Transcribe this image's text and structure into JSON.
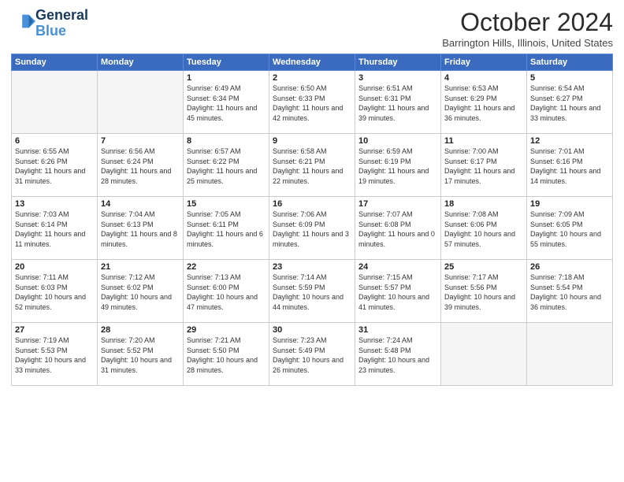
{
  "header": {
    "logo_line1": "General",
    "logo_line2": "Blue",
    "month_title": "October 2024",
    "subtitle": "Barrington Hills, Illinois, United States"
  },
  "weekdays": [
    "Sunday",
    "Monday",
    "Tuesday",
    "Wednesday",
    "Thursday",
    "Friday",
    "Saturday"
  ],
  "weeks": [
    [
      {
        "day": "",
        "info": ""
      },
      {
        "day": "",
        "info": ""
      },
      {
        "day": "1",
        "info": "Sunrise: 6:49 AM\nSunset: 6:34 PM\nDaylight: 11 hours and 45 minutes."
      },
      {
        "day": "2",
        "info": "Sunrise: 6:50 AM\nSunset: 6:33 PM\nDaylight: 11 hours and 42 minutes."
      },
      {
        "day": "3",
        "info": "Sunrise: 6:51 AM\nSunset: 6:31 PM\nDaylight: 11 hours and 39 minutes."
      },
      {
        "day": "4",
        "info": "Sunrise: 6:53 AM\nSunset: 6:29 PM\nDaylight: 11 hours and 36 minutes."
      },
      {
        "day": "5",
        "info": "Sunrise: 6:54 AM\nSunset: 6:27 PM\nDaylight: 11 hours and 33 minutes."
      }
    ],
    [
      {
        "day": "6",
        "info": "Sunrise: 6:55 AM\nSunset: 6:26 PM\nDaylight: 11 hours and 31 minutes."
      },
      {
        "day": "7",
        "info": "Sunrise: 6:56 AM\nSunset: 6:24 PM\nDaylight: 11 hours and 28 minutes."
      },
      {
        "day": "8",
        "info": "Sunrise: 6:57 AM\nSunset: 6:22 PM\nDaylight: 11 hours and 25 minutes."
      },
      {
        "day": "9",
        "info": "Sunrise: 6:58 AM\nSunset: 6:21 PM\nDaylight: 11 hours and 22 minutes."
      },
      {
        "day": "10",
        "info": "Sunrise: 6:59 AM\nSunset: 6:19 PM\nDaylight: 11 hours and 19 minutes."
      },
      {
        "day": "11",
        "info": "Sunrise: 7:00 AM\nSunset: 6:17 PM\nDaylight: 11 hours and 17 minutes."
      },
      {
        "day": "12",
        "info": "Sunrise: 7:01 AM\nSunset: 6:16 PM\nDaylight: 11 hours and 14 minutes."
      }
    ],
    [
      {
        "day": "13",
        "info": "Sunrise: 7:03 AM\nSunset: 6:14 PM\nDaylight: 11 hours and 11 minutes."
      },
      {
        "day": "14",
        "info": "Sunrise: 7:04 AM\nSunset: 6:13 PM\nDaylight: 11 hours and 8 minutes."
      },
      {
        "day": "15",
        "info": "Sunrise: 7:05 AM\nSunset: 6:11 PM\nDaylight: 11 hours and 6 minutes."
      },
      {
        "day": "16",
        "info": "Sunrise: 7:06 AM\nSunset: 6:09 PM\nDaylight: 11 hours and 3 minutes."
      },
      {
        "day": "17",
        "info": "Sunrise: 7:07 AM\nSunset: 6:08 PM\nDaylight: 11 hours and 0 minutes."
      },
      {
        "day": "18",
        "info": "Sunrise: 7:08 AM\nSunset: 6:06 PM\nDaylight: 10 hours and 57 minutes."
      },
      {
        "day": "19",
        "info": "Sunrise: 7:09 AM\nSunset: 6:05 PM\nDaylight: 10 hours and 55 minutes."
      }
    ],
    [
      {
        "day": "20",
        "info": "Sunrise: 7:11 AM\nSunset: 6:03 PM\nDaylight: 10 hours and 52 minutes."
      },
      {
        "day": "21",
        "info": "Sunrise: 7:12 AM\nSunset: 6:02 PM\nDaylight: 10 hours and 49 minutes."
      },
      {
        "day": "22",
        "info": "Sunrise: 7:13 AM\nSunset: 6:00 PM\nDaylight: 10 hours and 47 minutes."
      },
      {
        "day": "23",
        "info": "Sunrise: 7:14 AM\nSunset: 5:59 PM\nDaylight: 10 hours and 44 minutes."
      },
      {
        "day": "24",
        "info": "Sunrise: 7:15 AM\nSunset: 5:57 PM\nDaylight: 10 hours and 41 minutes."
      },
      {
        "day": "25",
        "info": "Sunrise: 7:17 AM\nSunset: 5:56 PM\nDaylight: 10 hours and 39 minutes."
      },
      {
        "day": "26",
        "info": "Sunrise: 7:18 AM\nSunset: 5:54 PM\nDaylight: 10 hours and 36 minutes."
      }
    ],
    [
      {
        "day": "27",
        "info": "Sunrise: 7:19 AM\nSunset: 5:53 PM\nDaylight: 10 hours and 33 minutes."
      },
      {
        "day": "28",
        "info": "Sunrise: 7:20 AM\nSunset: 5:52 PM\nDaylight: 10 hours and 31 minutes."
      },
      {
        "day": "29",
        "info": "Sunrise: 7:21 AM\nSunset: 5:50 PM\nDaylight: 10 hours and 28 minutes."
      },
      {
        "day": "30",
        "info": "Sunrise: 7:23 AM\nSunset: 5:49 PM\nDaylight: 10 hours and 26 minutes."
      },
      {
        "day": "31",
        "info": "Sunrise: 7:24 AM\nSunset: 5:48 PM\nDaylight: 10 hours and 23 minutes."
      },
      {
        "day": "",
        "info": ""
      },
      {
        "day": "",
        "info": ""
      }
    ]
  ]
}
